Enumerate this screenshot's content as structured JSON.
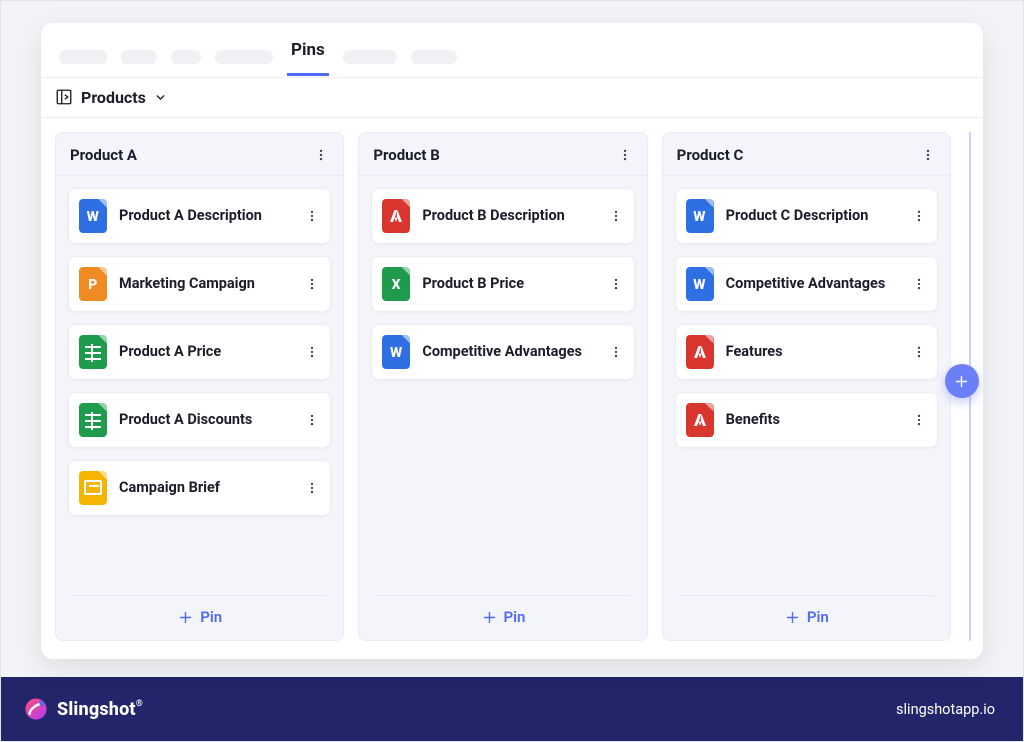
{
  "active_tab": "Pins",
  "breadcrumb": {
    "title": "Products"
  },
  "add_pin_label": "Pin",
  "columns": [
    {
      "title": "Product A",
      "cards": [
        {
          "label": "Product A Description",
          "type": "word"
        },
        {
          "label": "Marketing Campaign",
          "type": "ppt"
        },
        {
          "label": "Product A Price",
          "type": "sheets"
        },
        {
          "label": "Product A Discounts",
          "type": "sheets"
        },
        {
          "label": "Campaign Brief",
          "type": "gslides"
        }
      ]
    },
    {
      "title": "Product B",
      "cards": [
        {
          "label": "Product B Description",
          "type": "pdf"
        },
        {
          "label": "Product B Price",
          "type": "excel"
        },
        {
          "label": "Competitive Advantages",
          "type": "word"
        }
      ]
    },
    {
      "title": "Product C",
      "cards": [
        {
          "label": "Product C Description",
          "type": "word"
        },
        {
          "label": "Competitive Advantages",
          "type": "word"
        },
        {
          "label": "Features",
          "type": "pdf"
        },
        {
          "label": "Benefits",
          "type": "pdf"
        }
      ]
    }
  ],
  "footer": {
    "brand": "Slingshot",
    "url": "slingshotapp.io"
  },
  "icon_glyphs": {
    "word": "W",
    "pdf": "",
    "ppt": "P",
    "excel": "X",
    "sheets": "",
    "gslides": ""
  }
}
